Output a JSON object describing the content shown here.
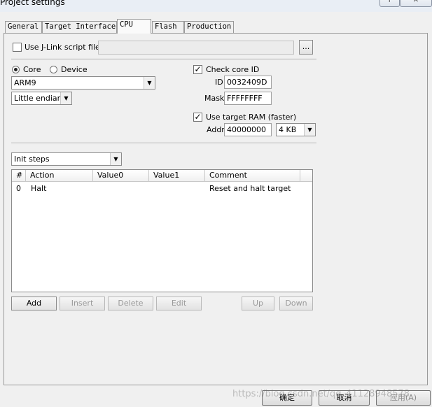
{
  "window": {
    "title": "Project settings",
    "help_label": "?",
    "close_label": "✕"
  },
  "tabs": [
    {
      "label": "General"
    },
    {
      "label": "Target Interface"
    },
    {
      "label": "CPU"
    },
    {
      "label": "Flash"
    },
    {
      "label": "Production"
    }
  ],
  "jlink_script": {
    "label": "Use J-Link script file",
    "checked": false,
    "value": "",
    "browse_label": "..."
  },
  "core": {
    "core_label": "Core",
    "device_label": "Device",
    "selected": "Core",
    "core_value": "ARM9",
    "endian_value": "Little endian"
  },
  "check_core_id": {
    "label": "Check core ID",
    "checked": true,
    "id_label": "ID",
    "id_value": "0032409D",
    "mask_label": "Mask",
    "mask_value": "FFFFFFFF"
  },
  "target_ram": {
    "label": "Use target RAM (faster)",
    "checked": true,
    "addr_label": "Addr",
    "addr_value": "40000000",
    "size_value": "4 KB"
  },
  "steps": {
    "dropdown_value": "Init steps",
    "columns": [
      "#",
      "Action",
      "Value0",
      "Value1",
      "Comment"
    ],
    "rows": [
      {
        "num": "0",
        "action": "Halt",
        "value0": "",
        "value1": "",
        "comment": "Reset and halt target"
      }
    ],
    "buttons": {
      "add": "Add",
      "insert": "Insert",
      "delete": "Delete",
      "edit": "Edit",
      "up": "Up",
      "down": "Down"
    }
  },
  "dialog_buttons": {
    "ok": "确定",
    "cancel": "取消",
    "apply": "应用(A)"
  },
  "watermark": "https://blog.csdn.net/qq_41128948578"
}
